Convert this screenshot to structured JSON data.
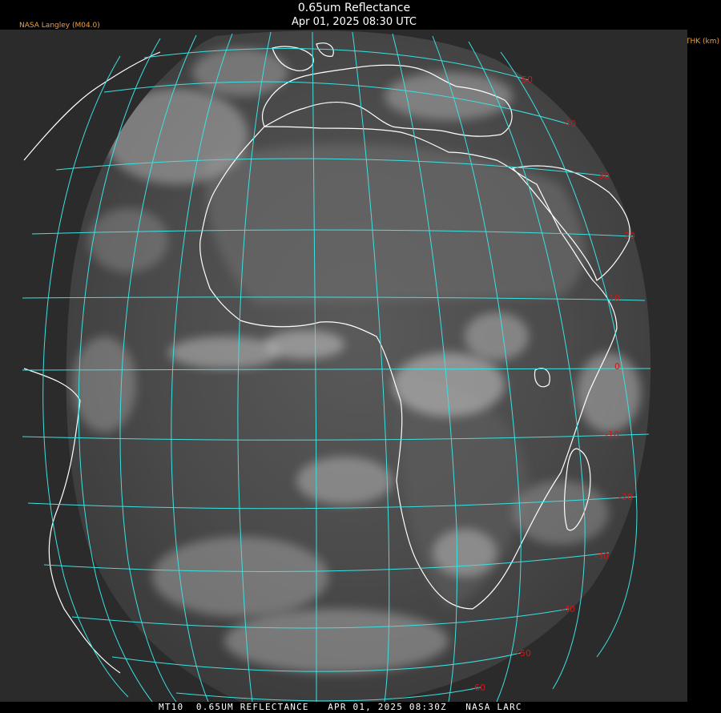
{
  "header": {
    "title": "0.65um Reflectance",
    "subtitle": "Apr 01, 2025 08:30 UTC",
    "org_label": "NASA Langley (M04.0)",
    "param_label": "ZTHK (km)"
  },
  "footer": {
    "text": "MT10  0.65UM REFLECTANCE   APR 01, 2025 08:30Z   NASA LARC"
  },
  "image": {
    "description_colors": {
      "grid": "#3ee0e0",
      "coastline": "#ffffff",
      "lat_label": "#d01818",
      "org_label": "#f0a040",
      "space": "#2b2b2b"
    }
  },
  "lat_labels": [
    {
      "text": "50"
    },
    {
      "text": "40"
    },
    {
      "text": "30"
    },
    {
      "text": "20"
    },
    {
      "text": "10"
    },
    {
      "text": "0"
    },
    {
      "text": "-10"
    },
    {
      "text": "-20"
    },
    {
      "text": "-30"
    },
    {
      "text": "-40"
    },
    {
      "text": "-50"
    },
    {
      "text": "-60"
    }
  ]
}
